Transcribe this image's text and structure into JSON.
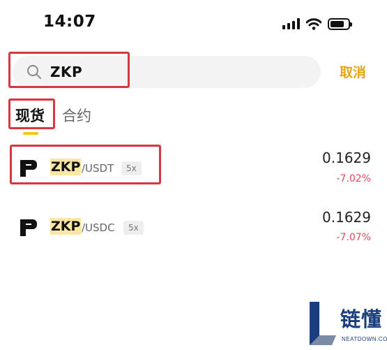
{
  "status_bar": {
    "time": "14:07",
    "icons": [
      "signal-icon",
      "wifi-icon",
      "battery-icon"
    ]
  },
  "search": {
    "value": "ZKP",
    "icon": "search-icon",
    "cancel_label": "取消"
  },
  "tabs": [
    {
      "label": "现货",
      "active": true
    },
    {
      "label": "合约",
      "active": false
    }
  ],
  "results": [
    {
      "base": "ZKP",
      "quote": "/USDT",
      "leverage": "5x",
      "price": "0.1629",
      "change": "-7.02%",
      "icon": "zkp-logo-icon"
    },
    {
      "base": "ZKP",
      "quote": "/USDC",
      "leverage": "5x",
      "price": "0.1629",
      "change": "-7.07%",
      "icon": "zkp-logo-icon"
    }
  ],
  "watermark": {
    "text": "链懂",
    "sub": "NEATDOWN.COM"
  },
  "colors": {
    "accent": "#e6a411",
    "highlight": "#fbe6a6",
    "negative": "#e04a5a",
    "annotation": "#d7373f",
    "tab_underline": "#f5c518"
  }
}
